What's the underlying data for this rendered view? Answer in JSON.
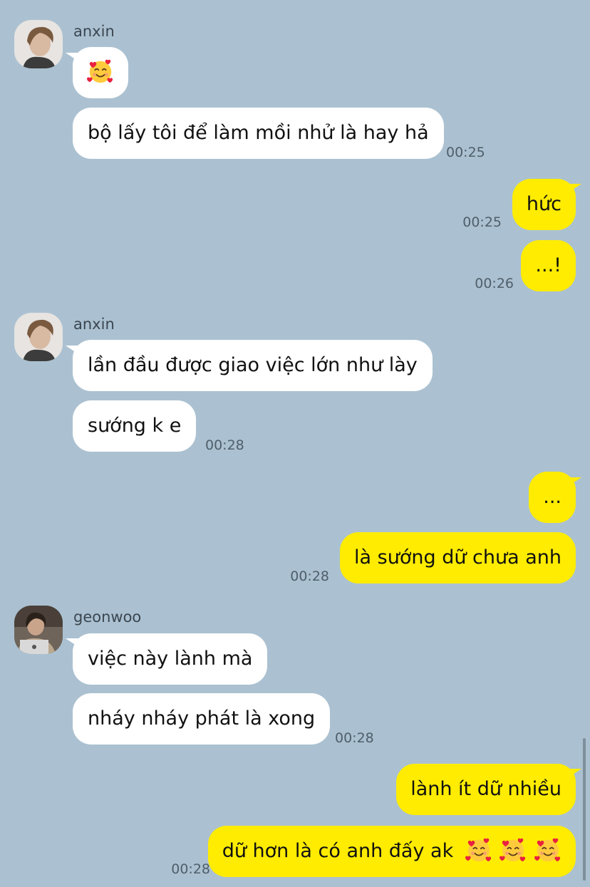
{
  "messages": [
    {
      "sender": "anxin",
      "text": "bộ lấy tôi để làm mồi nhử là hay hả",
      "time": "00:25"
    },
    {
      "sender": "me",
      "text": "hức",
      "time": "00:25"
    },
    {
      "sender": "me",
      "text": "...!",
      "time": "00:26"
    },
    {
      "sender": "anxin",
      "text": "lần đầu được giao việc lớn như lày"
    },
    {
      "sender": "anxin",
      "text": "sướng k e",
      "time": "00:28"
    },
    {
      "sender": "me",
      "text": "..."
    },
    {
      "sender": "me",
      "text": "là sướng dữ chưa anh",
      "time": "00:28"
    },
    {
      "sender": "geonwoo",
      "text": "việc này lành mà"
    },
    {
      "sender": "geonwoo",
      "text": "nháy nháy phát là xong",
      "time": "00:28"
    },
    {
      "sender": "me",
      "text": "lành ít dữ nhiều"
    },
    {
      "sender": "me",
      "text": "dữ hơn là có anh đấy ak",
      "time": "00:28"
    }
  ],
  "senders": {
    "anxin": "anxin",
    "geonwoo": "geonwoo"
  },
  "icons": {
    "reaction_emoji": "smiling-face-with-hearts-icon"
  },
  "colors": {
    "background": "#abc1d1",
    "outgoing": "#ffec00",
    "incoming": "#ffffff"
  }
}
